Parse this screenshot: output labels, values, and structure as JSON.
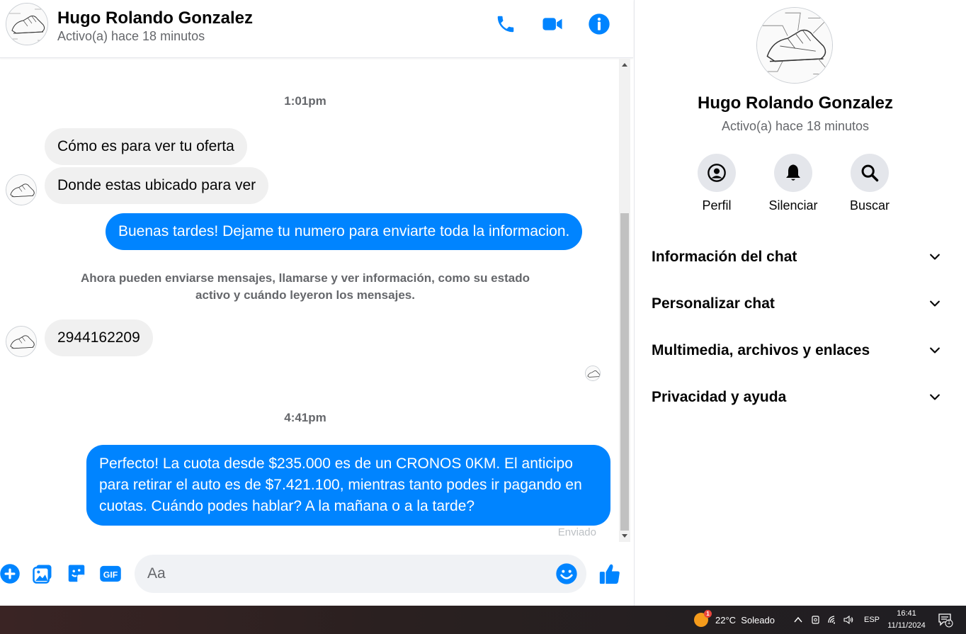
{
  "contact": {
    "name": "Hugo Rolando Gonzalez",
    "status": "Activo(a) hace 18 minutos"
  },
  "header_actions": {
    "call_icon": "phone-icon",
    "video_icon": "video-camera-icon",
    "info_icon": "info-icon"
  },
  "messages": [
    {
      "type": "timestamp",
      "text": "1:01pm"
    },
    {
      "type": "incoming",
      "text": "Cómo es para ver tu oferta"
    },
    {
      "type": "incoming",
      "text": "Donde estas ubicado para ver"
    },
    {
      "type": "outgoing",
      "text": "Buenas tardes! Dejame tu numero para enviarte toda la informacion."
    },
    {
      "type": "system",
      "text": "Ahora pueden enviarse mensajes, llamarse y ver información, como su estado activo y cuándo leyeron los mensajes."
    },
    {
      "type": "incoming",
      "text": "2944162209"
    },
    {
      "type": "timestamp",
      "text": "4:41pm"
    },
    {
      "type": "outgoing",
      "text": "Perfecto! La cuota desde $235.000 es de un CRONOS 0KM. El anticipo para retirar el auto es de $7.421.100, mientras tanto podes ir pagando en cuotas. Cuándo podes hablar? A la mañana o a la tarde?"
    }
  ],
  "sent_status": "Enviado",
  "composer": {
    "placeholder": "Aa",
    "value": "",
    "icons": [
      "plus-icon",
      "photo-icon",
      "sticker-icon",
      "gif-icon",
      "emoji-icon",
      "like-icon"
    ],
    "gif_label": "GIF"
  },
  "info_panel": {
    "actions": [
      {
        "label": "Perfil",
        "icon": "profile-icon"
      },
      {
        "label": "Silenciar",
        "icon": "bell-icon"
      },
      {
        "label": "Buscar",
        "icon": "search-icon"
      }
    ],
    "sections": [
      {
        "title": "Información del chat"
      },
      {
        "title": "Personalizar chat"
      },
      {
        "title": "Multimedia, archivos y enlaces"
      },
      {
        "title": "Privacidad y ayuda"
      }
    ]
  },
  "taskbar": {
    "weather": "22°C  Soleado",
    "weather_badge": "1",
    "language": "ESP",
    "time": "16:41",
    "date": "11/11/2024",
    "notification_badge": "1"
  },
  "colors": {
    "accent": "#0084ff",
    "incoming_bubble": "#f0f0f0",
    "secondary_text": "#65676b"
  }
}
